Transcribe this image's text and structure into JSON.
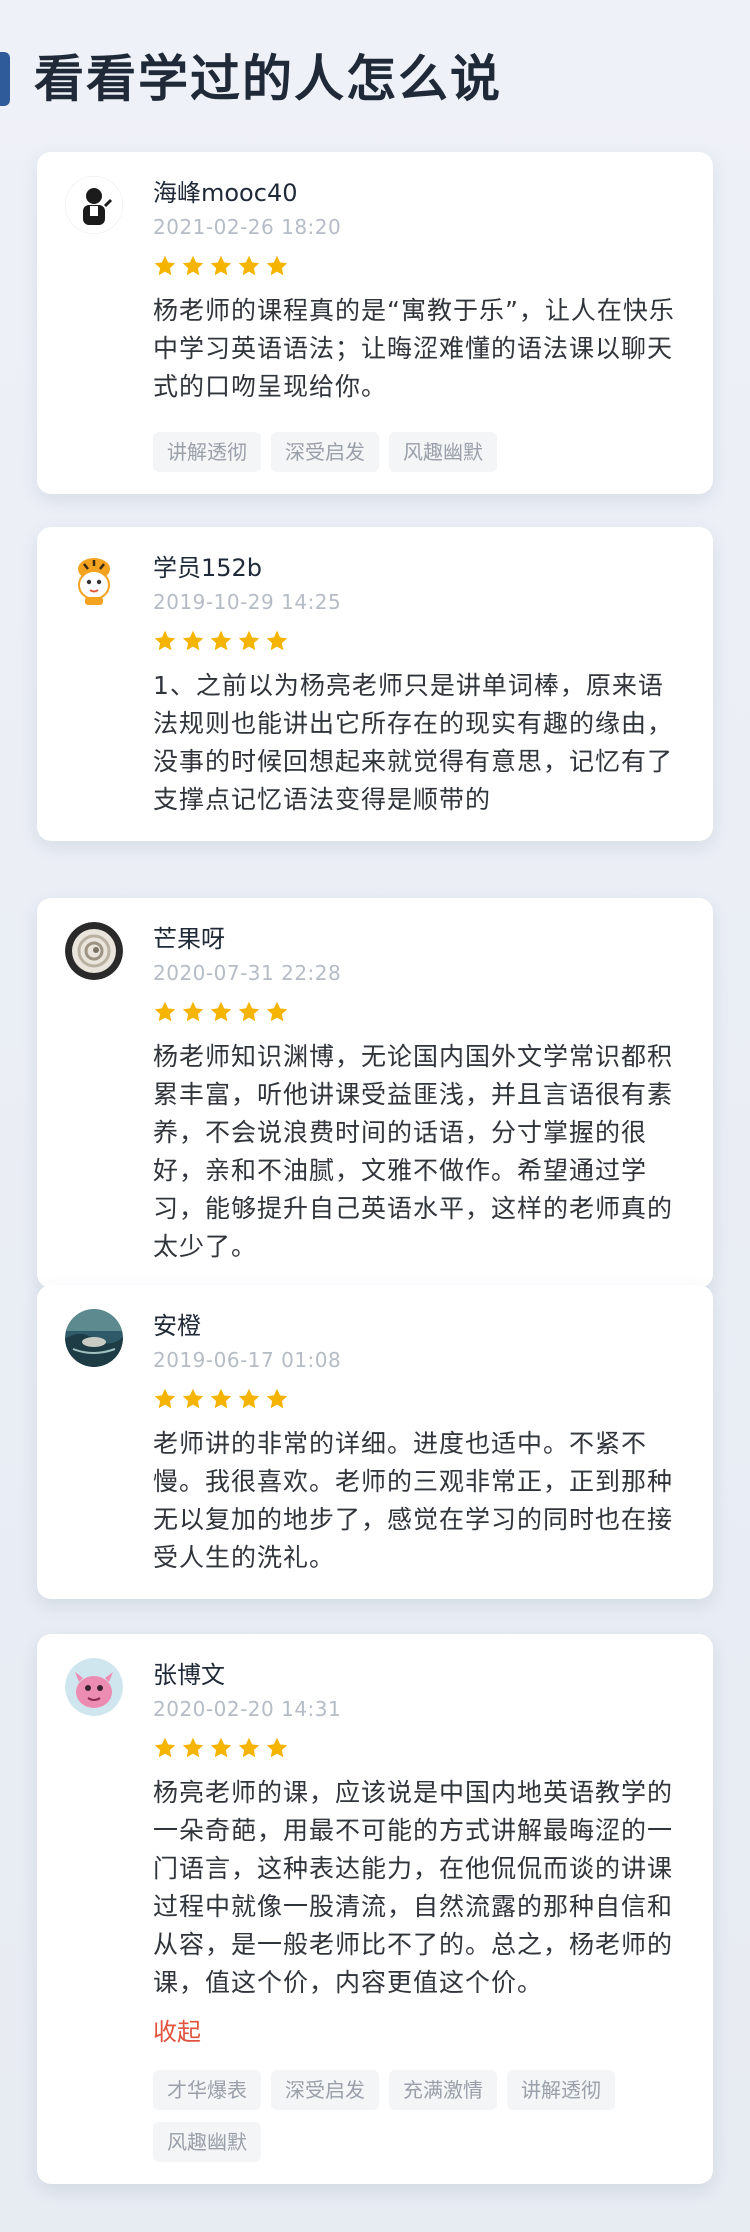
{
  "section": {
    "title": "看看学过的人怎么说"
  },
  "colors": {
    "accent_bar": "#2f5b9b",
    "star": "#f5b400",
    "collapse": "#e0533f"
  },
  "reviews": [
    {
      "user": "海峰mooc40",
      "time": "2021-02-26 18:20",
      "rating": 5,
      "avatar_icon": "cartoon-person-avatar",
      "content": "杨老师的课程真的是“寓教于乐”，让人在快乐中学习英语语法；让晦涩难懂的语法课以聊天式的口吻呈现给你。",
      "tags": [
        "讲解透彻",
        "深受启发",
        "风趣幽默"
      ]
    },
    {
      "user": "学员152b",
      "time": "2019-10-29 14:25",
      "rating": 5,
      "avatar_icon": "tiger-mascot-avatar",
      "content": "1、之前以为杨亮老师只是讲单词棒，原来语法规则也能讲出它所存在的现实有趣的缘由，没事的时候回想起来就觉得有意思，记忆有了支撑点记忆语法变得是顺带的",
      "tags": []
    },
    {
      "user": "芒果呀",
      "time": "2020-07-31 22:28",
      "rating": 5,
      "avatar_icon": "shell-photo-avatar",
      "content": "杨老师知识渊博，无论国内国外文学常识都积累丰富，听他讲课受益匪浅，并且言语很有素养，不会说浪费时间的话语，分寸掌握的很好，亲和不油腻，文雅不做作。希望通过学习，能够提升自己英语水平，这样的老师真的太少了。",
      "tags": []
    },
    {
      "user": "安橙",
      "time": "2019-06-17 01:08",
      "rating": 5,
      "avatar_icon": "landscape-photo-avatar",
      "content": "老师讲的非常的详细。进度也适中。不紧不慢。我很喜欢。老师的三观非常正，正到那种无以复加的地步了，感觉在学习的同时也在接受人生的洗礼。",
      "tags": []
    },
    {
      "user": "张博文",
      "time": "2020-02-20 14:31",
      "rating": 5,
      "avatar_icon": "pink-monster-avatar",
      "content": "杨亮老师的课，应该说是中国内地英语教学的一朵奇葩，用最不可能的方式讲解最晦涩的一门语言，这种表达能力，在他侃侃而谈的讲课过程中就像一股清流，自然流露的那种自信和从容，是一般老师比不了的。总之，杨老师的课，值这个价，内容更值这个价。",
      "collapse_label": "收起",
      "tags": [
        "才华爆表",
        "深受启发",
        "充满激情",
        "讲解透彻",
        "风趣幽默"
      ]
    }
  ]
}
